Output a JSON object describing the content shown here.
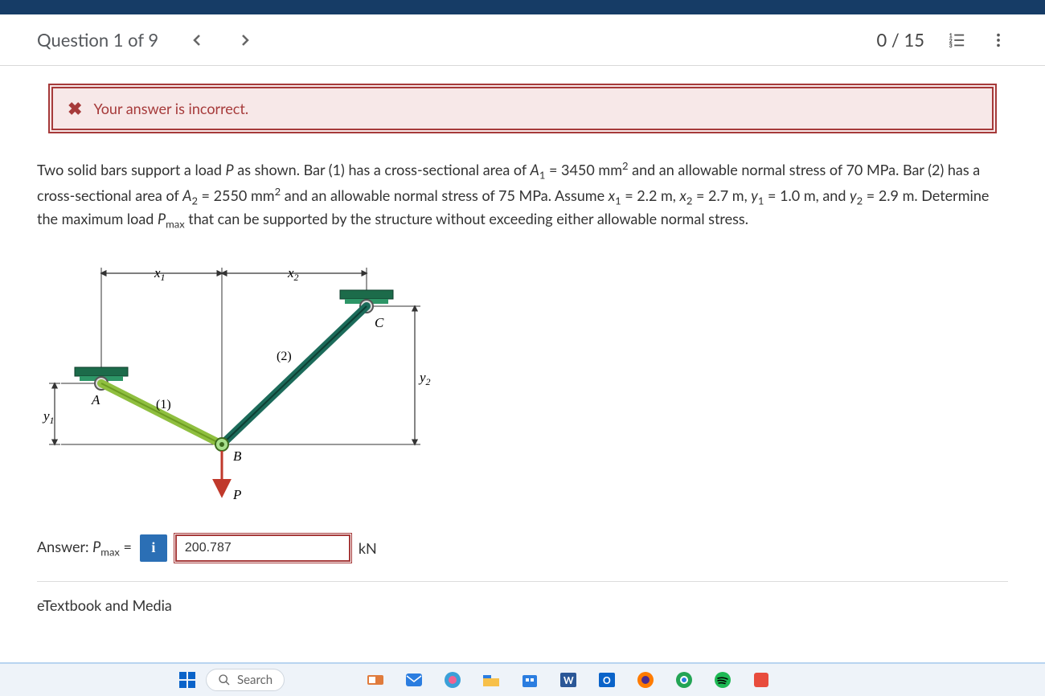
{
  "header": {
    "title": "Question 1 of 9",
    "score": "0 / 15"
  },
  "alert": {
    "text": "Your answer is incorrect."
  },
  "problem": {
    "html": "Two solid bars support a load <i>P</i> as shown. Bar (1) has a cross-sectional area of <i>A</i><sub>1</sub> = 3450 mm<sup>2</sup> and an allowable normal stress of 70 MPa. Bar (2) has a cross-sectional area of <i>A</i><sub>2</sub> = 2550 mm<sup>2</sup> and an allowable normal stress of 75 MPa. Assume <i>x</i><sub>1</sub> = 2.2 m, <i>x</i><sub>2</sub> = 2.7 m, <i>y</i><sub>1</sub> = 1.0 m, and <i>y</i><sub>2</sub> = 2.9 m. Determine the maximum load <i>P</i><sub>max</sub> that can be supported by the structure without exceeding either allowable normal stress."
  },
  "diagram": {
    "labels": {
      "x1": "x",
      "x2": "x",
      "y1": "y",
      "y2": "y",
      "A": "A",
      "B": "B",
      "C": "C",
      "P": "P",
      "bar1": "(1)",
      "bar2": "(2)"
    }
  },
  "answer": {
    "label_html": "Answer: <i>P</i><sub>max</sub> =",
    "value": "200.787",
    "unit": "kN"
  },
  "etextbook": {
    "label": "eTextbook and Media"
  },
  "taskbar": {
    "search_placeholder": "Search"
  }
}
